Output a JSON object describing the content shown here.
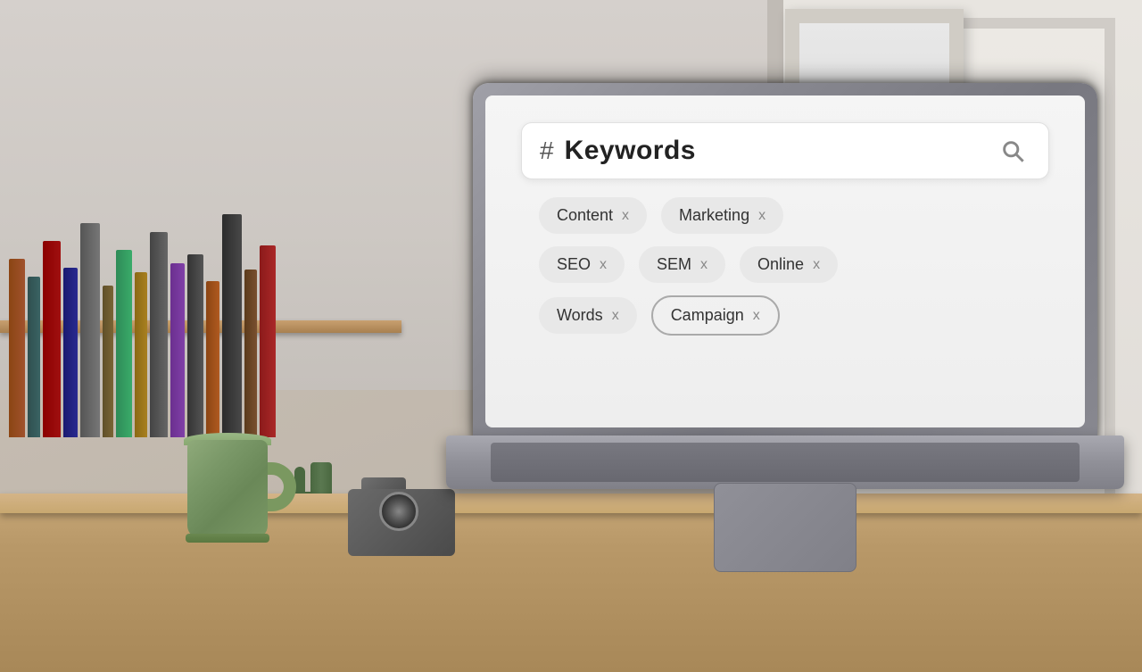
{
  "scene": {
    "background_color": "#c8bfb0"
  },
  "laptop": {
    "screen": {
      "search_bar": {
        "hash_symbol": "#",
        "keyword_value": "Keywords",
        "search_icon_label": "search"
      },
      "tags": [
        {
          "row": 1,
          "items": [
            {
              "label": "Content",
              "close": "x"
            },
            {
              "label": "Marketing",
              "close": "x"
            }
          ]
        },
        {
          "row": 2,
          "items": [
            {
              "label": "SEO",
              "close": "x"
            },
            {
              "label": "SEM",
              "close": "x"
            },
            {
              "label": "Online",
              "close": "x"
            }
          ]
        },
        {
          "row": 3,
          "items": [
            {
              "label": "Words",
              "close": "x",
              "outlined": false
            },
            {
              "label": "Campaign",
              "close": "x",
              "outlined": true
            }
          ]
        }
      ]
    }
  },
  "mug": {
    "color": "#7a9865",
    "label": "green mug"
  },
  "books": {
    "label": "bookshelf with books"
  },
  "camera": {
    "label": "vintage camera"
  },
  "cactus": {
    "label": "small cactus plant"
  },
  "desk": {
    "color": "#c8a878",
    "label": "wooden desk"
  },
  "tags_data": {
    "row1": {
      "tag1_label": "Content",
      "tag1_close": "x",
      "tag2_label": "Marketing",
      "tag2_close": "x"
    },
    "row2": {
      "tag1_label": "SEO",
      "tag1_close": "x",
      "tag2_label": "SEM",
      "tag2_close": "x",
      "tag3_label": "Online",
      "tag3_close": "x"
    },
    "row3": {
      "tag1_label": "Words",
      "tag1_close": "x",
      "tag2_label": "Campaign",
      "tag2_close": "x"
    }
  }
}
